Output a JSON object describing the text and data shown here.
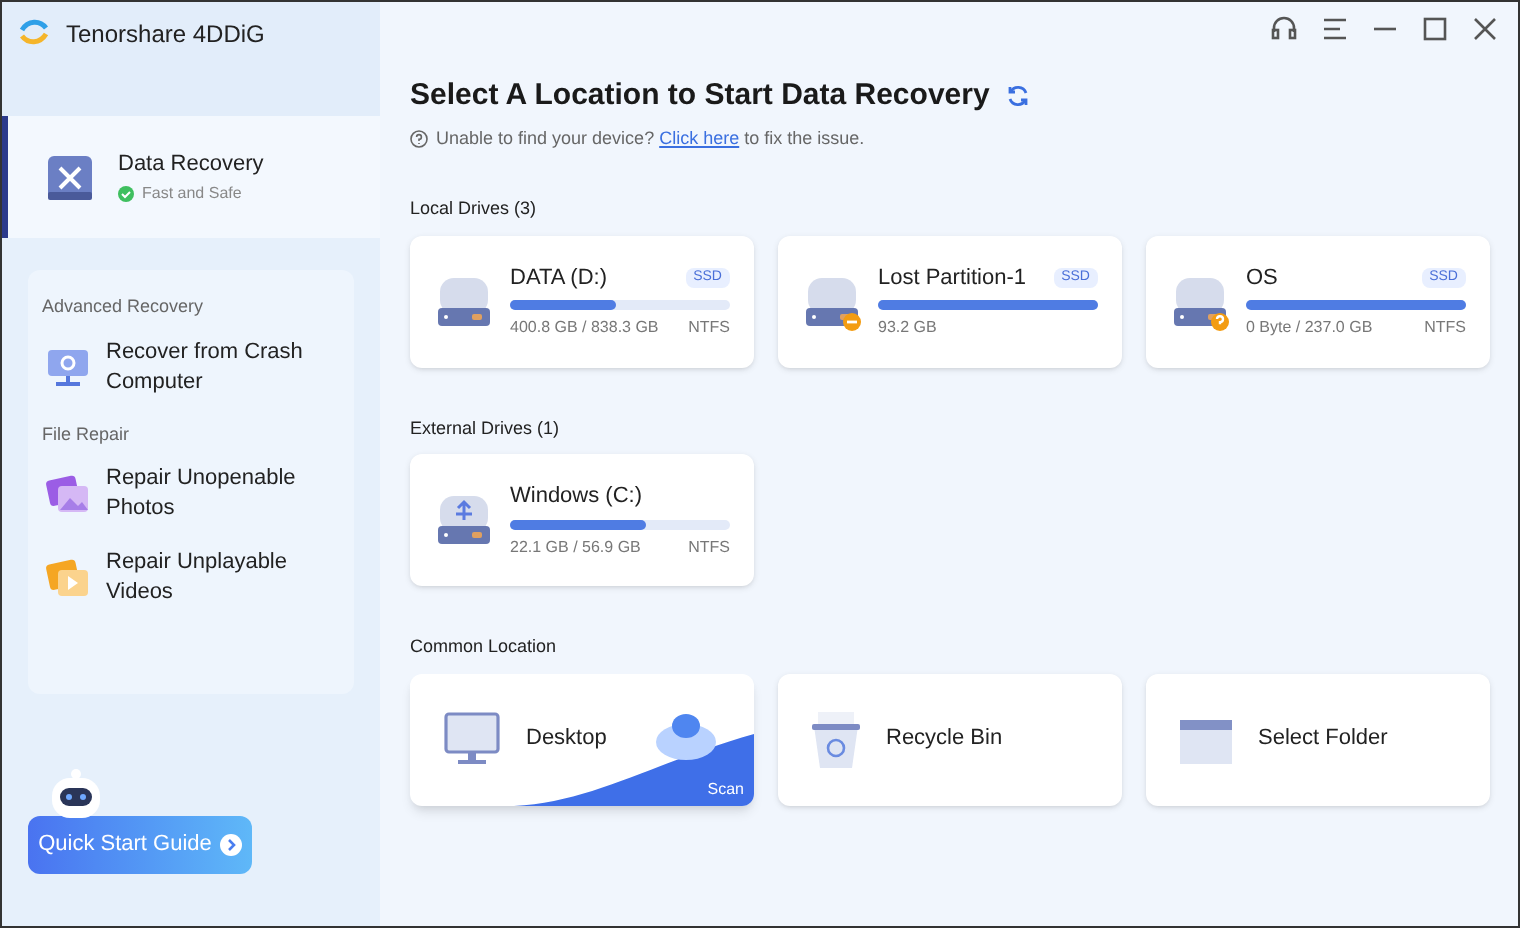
{
  "app": {
    "title": "Tenorshare 4DDiG"
  },
  "sidebar": {
    "main_item": {
      "label": "Data Recovery",
      "sublabel": "Fast and Safe",
      "selected": true
    },
    "groups": [
      {
        "heading": "Advanced Recovery",
        "items": [
          {
            "label": "Recover from Crash Computer",
            "kind": "crash"
          }
        ]
      },
      {
        "heading": "File Repair",
        "items": [
          {
            "label": "Repair Unopenable Photos",
            "kind": "photo"
          },
          {
            "label": "Repair Unplayable Videos",
            "kind": "video"
          }
        ]
      }
    ],
    "guide_button": "Quick Start Guide"
  },
  "main": {
    "title": "Select A Location to Start Data Recovery",
    "help": {
      "before": "Unable to find your device?",
      "link": "Click here",
      "after": "to fix the issue."
    },
    "sections": [
      {
        "heading": "Local Drives (3)",
        "drives": [
          {
            "name": "DATA (D:)",
            "badge": "SSD",
            "kind": "normal",
            "level": 0.48,
            "size": "400.8 GB / 838.3 GB",
            "fs": "NTFS"
          },
          {
            "name": "Lost Partition-1",
            "badge": "SSD",
            "kind": "lost",
            "level": 1,
            "size": "93.2 GB"
          },
          {
            "name": "OS",
            "badge": "SSD",
            "kind": "unknown",
            "level": 1,
            "size": "0 Byte / 237.0 GB",
            "fs": "NTFS"
          }
        ]
      },
      {
        "heading": "External Drives (1)",
        "drives": [
          {
            "name": "Windows (C:)",
            "kind": "usb",
            "level": 0.62,
            "size": "22.1 GB / 56.9 GB",
            "fs": "NTFS"
          }
        ]
      }
    ],
    "common": {
      "heading": "Common Location",
      "items": [
        {
          "label": "Desktop",
          "kind": "desktop",
          "selected": true,
          "action": "Scan"
        },
        {
          "label": "Recycle Bin",
          "kind": "recycle",
          "selected": false
        },
        {
          "label": "Select Folder",
          "kind": "folder",
          "selected": false
        }
      ]
    }
  }
}
